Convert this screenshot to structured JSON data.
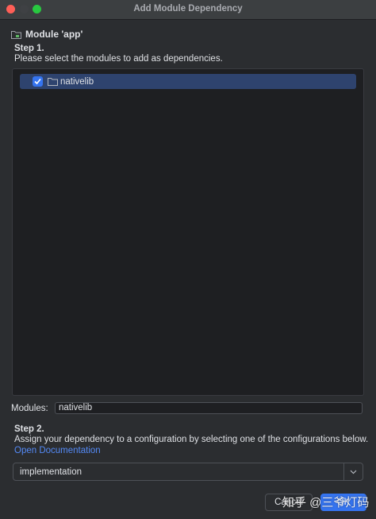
{
  "window": {
    "title": "Add Module Dependency"
  },
  "module_header": {
    "label": "Module 'app'",
    "icon": "module-folder-icon"
  },
  "step1": {
    "title": "Step 1.",
    "description": "Please select the modules to add as dependencies.",
    "tree": [
      {
        "label": "nativelib",
        "checked": true,
        "icon": "folder-icon"
      }
    ]
  },
  "modules_field": {
    "label": "Modules:",
    "value": "nativelib"
  },
  "step2": {
    "title": "Step 2.",
    "description": "Assign your dependency to a configuration by selecting one of the configurations below.",
    "link": "Open Documentation",
    "configuration": "implementation"
  },
  "buttons": {
    "cancel": "Cancel",
    "ok": "OK"
  },
  "watermark": "知乎 @三爷灯码",
  "colors": {
    "accent": "#3574f0",
    "selection": "#2e436e",
    "link": "#548af7",
    "background": "#2b2d30"
  }
}
